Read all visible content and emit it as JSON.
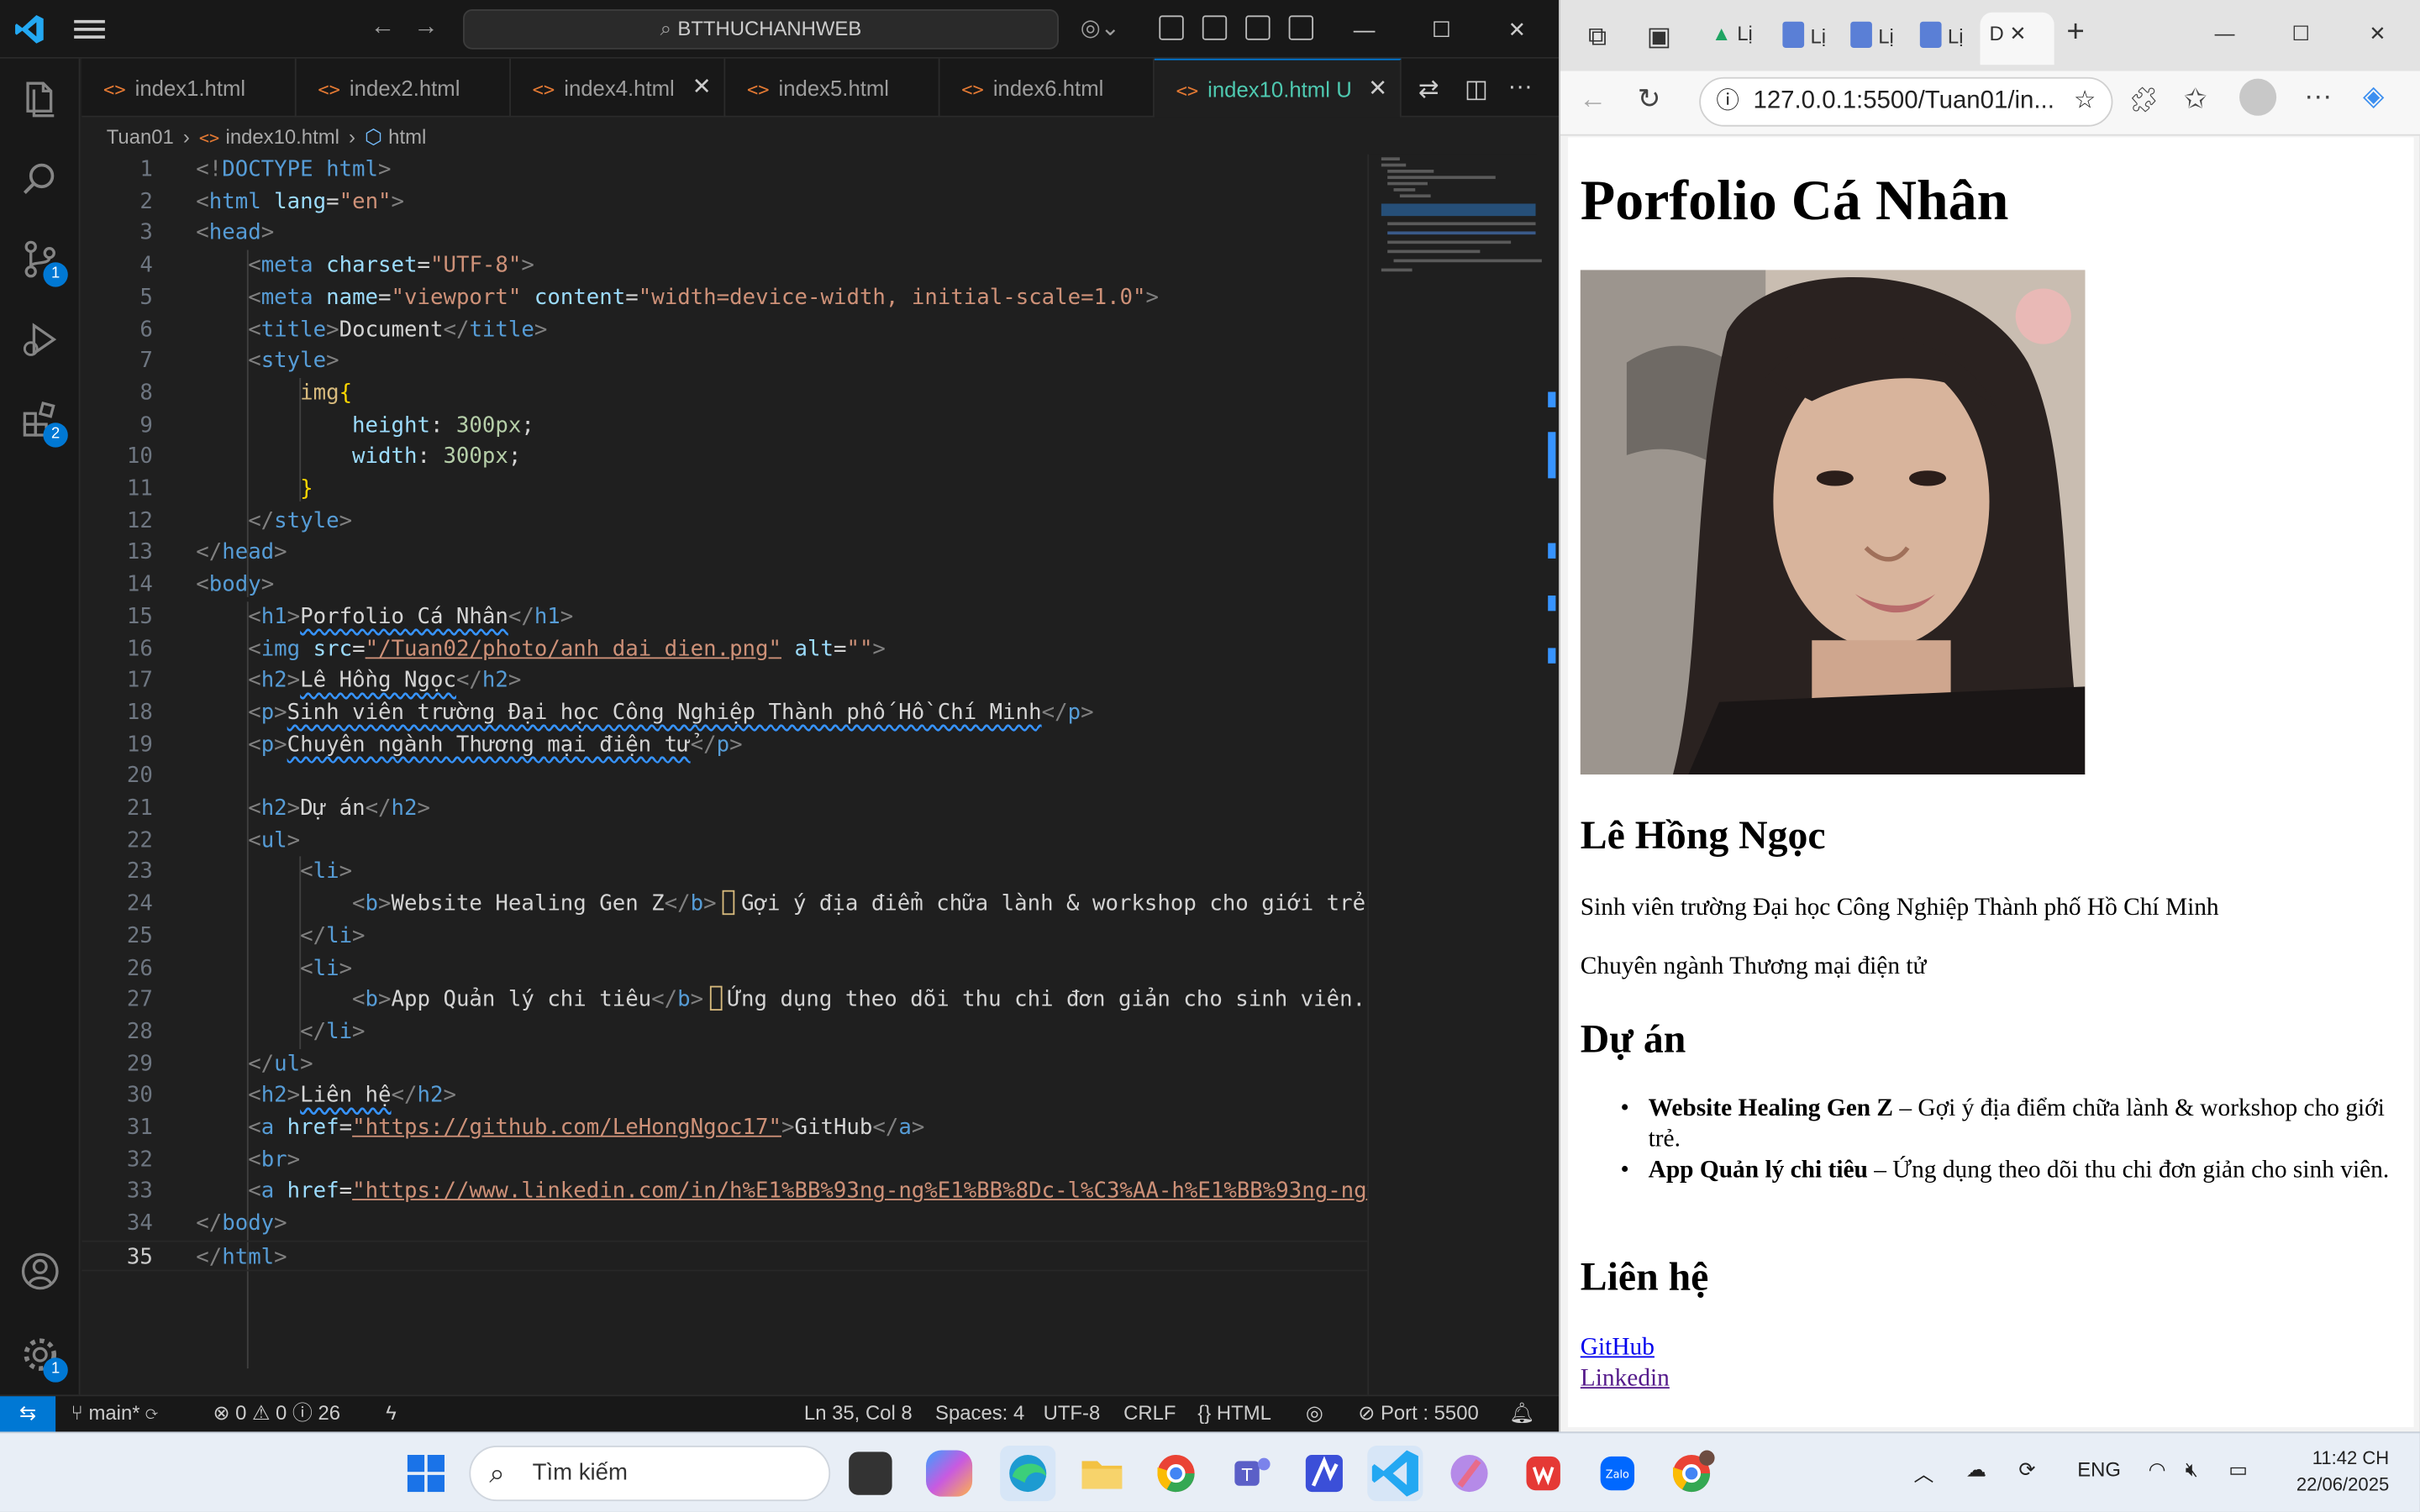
{
  "vscode": {
    "search_text": "BTTHUCHANHWEB",
    "tabs": [
      {
        "label": "index1.html"
      },
      {
        "label": "index2.html"
      },
      {
        "label": "index4.html"
      },
      {
        "label": "index5.html"
      },
      {
        "label": "index6.html"
      },
      {
        "label": "index10.html",
        "status": "U"
      }
    ],
    "breadcrumb": [
      "Tuan01",
      "index10.html",
      "html"
    ],
    "badges": {
      "source_control": "1",
      "extensions": "2",
      "settings": "1"
    },
    "line_numbers": [
      "1",
      "2",
      "3",
      "4",
      "5",
      "6",
      "7",
      "8",
      "9",
      "10",
      "11",
      "12",
      "13",
      "14",
      "15",
      "16",
      "17",
      "18",
      "19",
      "20",
      "21",
      "22",
      "23",
      "24",
      "25",
      "26",
      "27",
      "28",
      "29",
      "30",
      "31",
      "32",
      "33",
      "34",
      "35"
    ],
    "code": {
      "doctype": "DOCTYPE html",
      "lang": "\"en\"",
      "charset": "\"UTF-8\"",
      "viewport_content": "\"width=device-width, initial-scale=1.0\"",
      "title": "Document",
      "css_selector": "img",
      "css_height_prop": "height",
      "css_height_val": "300px",
      "css_width_prop": "width",
      "css_width_val": "300px",
      "h1": "Porfolio Cá Nhân",
      "img_src": "\"/Tuan02/photo/anh dai dien.png\"",
      "img_alt": "\"\"",
      "h2_name": "Lê Hồng Ngọc",
      "p1": "Sinh viên trường Đại học Công Nghiệp Thành phố Hồ Chí Minh",
      "p2": "Chuyên ngành Thương mại điện tử",
      "h2_projects": "Dự án",
      "li1_b": "Website Healing Gen Z",
      "li1_text": "Gợi ý địa điểm chữa lành & workshop cho giới trẻ",
      "li2_b": "App Quản lý chi tiêu",
      "li2_text": "Ứng dụng theo dõi thu chi đơn giản cho sinh viên.",
      "h2_contact": "Liên hệ",
      "github_url": "\"https://github.com/LeHongNgoc17\"",
      "github_text": "GitHub",
      "linkedin_url": "\"https://www.linkedin.com/in/h%E1%BB%93ng-ng%E1%BB%8Dc-l%C3%AA-h%E1%BB%93ng-ng%"
    },
    "status": {
      "branch": "main*",
      "problems": "⊗ 0 ⚠ 0 ⓘ 26",
      "position": "Ln 35, Col 8",
      "spaces": "Spaces: 4",
      "encoding": "UTF-8",
      "eol": "CRLF",
      "language": "HTML",
      "port": "Port : 5500"
    }
  },
  "browser": {
    "tab_labels": [
      "Lị",
      "Lị",
      "Lị",
      "Lị",
      "D"
    ],
    "address": "127.0.0.1:5500/Tuan01/in...",
    "page": {
      "h1": "Porfolio Cá Nhân",
      "name": "Lê Hồng Ngọc",
      "p1": "Sinh viên trường Đại học Công Nghiệp Thành phố Hồ Chí Minh",
      "p2": "Chuyên ngành Thương mại điện tử",
      "projects_heading": "Dự án",
      "projects": [
        {
          "title": "Website Healing Gen Z",
          "desc": " – Gợi ý địa điểm chữa lành & workshop cho giới trẻ."
        },
        {
          "title": "App Quản lý chi tiêu",
          "desc": " – Ứng dụng theo dõi thu chi đơn giản cho sinh viên."
        }
      ],
      "contact_heading": "Liên hệ",
      "links": [
        "GitHub",
        "Linkedin"
      ]
    }
  },
  "taskbar": {
    "search_placeholder": "Tìm kiếm",
    "language": "ENG",
    "time": "11:42 CH",
    "date": "22/06/2025"
  }
}
